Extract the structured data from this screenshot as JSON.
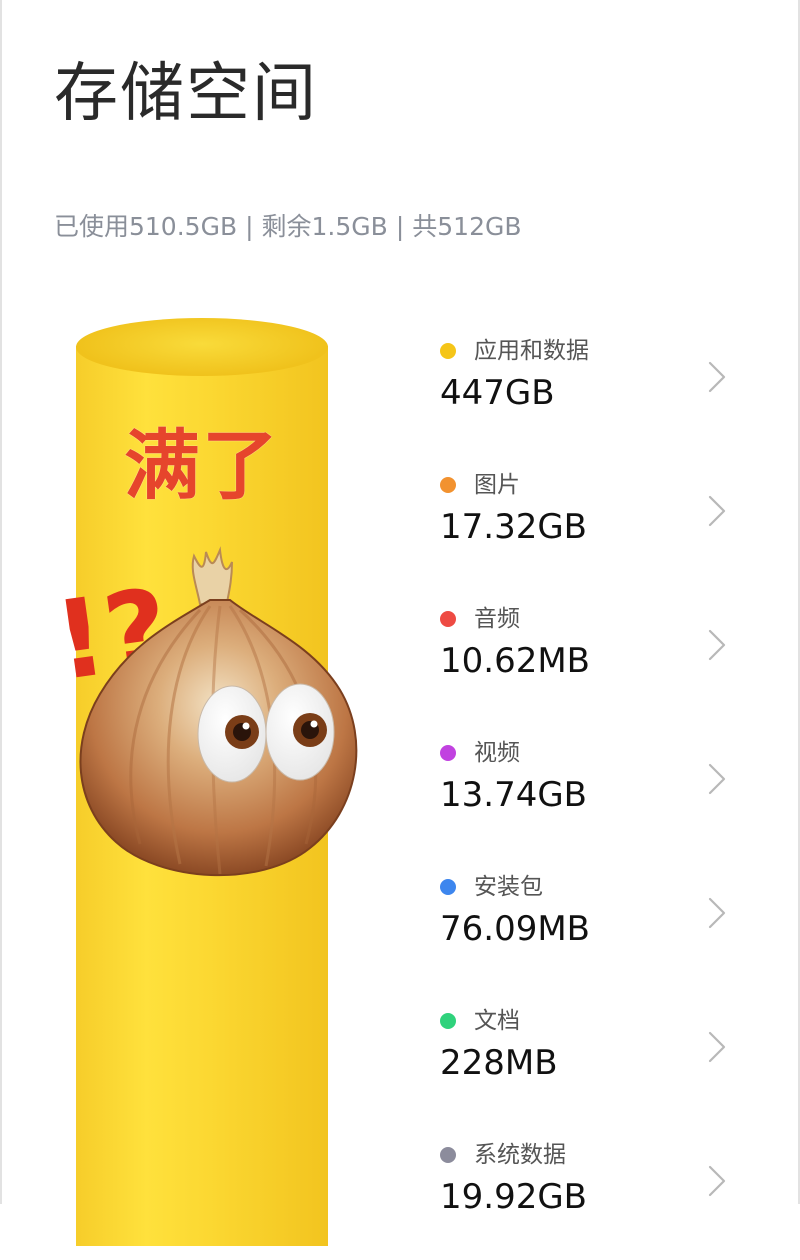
{
  "header": {
    "title": "存储空间",
    "summary": {
      "used": "已使用510.5GB",
      "remaining": "剩余1.5GB",
      "total": "共512GB",
      "separator": "|"
    }
  },
  "sticker": {
    "text": "满了",
    "symbols": "!?"
  },
  "storage_items": [
    {
      "label": "应用和数据",
      "value": "447GB",
      "color": "#f5c518",
      "icon": "chevron-right-icon"
    },
    {
      "label": "图片",
      "value": "17.32GB",
      "color": "#f2922f",
      "icon": "chevron-right-icon"
    },
    {
      "label": "音频",
      "value": "10.62MB",
      "color": "#ee4b43",
      "icon": "chevron-right-icon"
    },
    {
      "label": "视频",
      "value": "13.74GB",
      "color": "#c142e0",
      "icon": "chevron-right-icon"
    },
    {
      "label": "安装包",
      "value": "76.09MB",
      "color": "#3d86ee",
      "icon": "chevron-right-icon"
    },
    {
      "label": "文档",
      "value": "228MB",
      "color": "#2fd27c",
      "icon": "chevron-right-icon"
    },
    {
      "label": "系统数据",
      "value": "19.92GB",
      "color": "#8c8c9c",
      "icon": "chevron-right-icon"
    }
  ]
}
